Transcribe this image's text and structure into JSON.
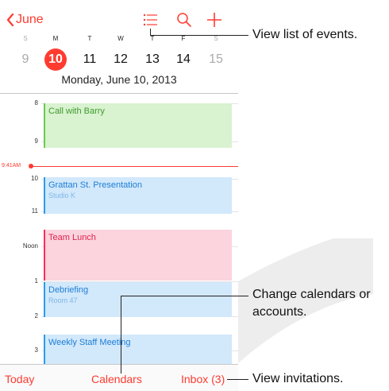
{
  "nav": {
    "back_label": "June"
  },
  "week": {
    "days": [
      {
        "letter": "S",
        "date": "9",
        "weekend": true,
        "today": false
      },
      {
        "letter": "M",
        "date": "10",
        "weekend": false,
        "today": true
      },
      {
        "letter": "T",
        "date": "11",
        "weekend": false,
        "today": false
      },
      {
        "letter": "W",
        "date": "12",
        "weekend": false,
        "today": false
      },
      {
        "letter": "T",
        "date": "13",
        "weekend": false,
        "today": false
      },
      {
        "letter": "F",
        "date": "14",
        "weekend": false,
        "today": false
      },
      {
        "letter": "S",
        "date": "15",
        "weekend": true,
        "today": false
      }
    ]
  },
  "day_title": "Monday, June 10, 2013",
  "timeline": {
    "hours": [
      "8",
      "9",
      "10",
      "11",
      "Noon",
      "1",
      "2",
      "3"
    ],
    "now_label": "9:41AM",
    "events": [
      {
        "title": "Call with Barry",
        "subtitle": "",
        "color": "green"
      },
      {
        "title": "Grattan St. Presentation",
        "subtitle": "Studio K",
        "color": "blue"
      },
      {
        "title": "Team Lunch",
        "subtitle": "",
        "color": "pink"
      },
      {
        "title": "Debriefing",
        "subtitle": "Room 47",
        "color": "blue"
      },
      {
        "title": "Weekly Staff Meeting",
        "subtitle": "",
        "color": "blue"
      }
    ]
  },
  "toolbar": {
    "today_label": "Today",
    "calendars_label": "Calendars",
    "inbox_label": "Inbox (3)"
  },
  "callouts": {
    "list_events": "View list of events.",
    "change_calendars_line1": "Change calendars or",
    "change_calendars_line2": "accounts.",
    "view_invitations": "View invitations."
  },
  "colors": {
    "accent": "#ff3b30",
    "event_green": "#d9f2d0",
    "event_blue": "#d2e8fb",
    "event_pink": "#fbd4de"
  },
  "icons": {
    "back": "chevron-left-icon",
    "list": "list-icon",
    "search": "search-icon",
    "add": "plus-icon"
  }
}
